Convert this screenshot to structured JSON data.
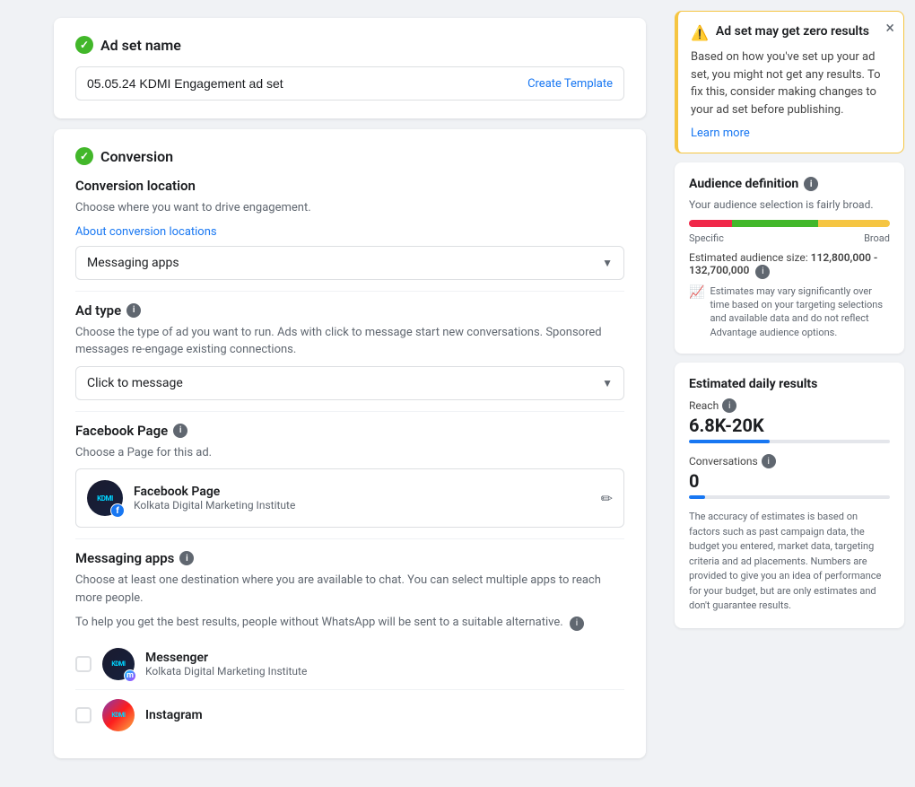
{
  "adset": {
    "section_title": "Ad set name",
    "name_value": "05.05.24 KDMI Engagement ad set",
    "create_template_label": "Create Template"
  },
  "conversion": {
    "section_title": "Conversion",
    "location_label": "Conversion location",
    "location_description": "Choose where you want to drive engagement.",
    "about_link": "About conversion locations",
    "location_dropdown": "Messaging apps",
    "ad_type_label": "Ad type",
    "ad_type_info": true,
    "ad_type_description": "Choose the type of ad you want to run. Ads with click to message start new conversations. Sponsored messages re-engage existing connections.",
    "ad_type_dropdown": "Click to message",
    "facebook_page_label": "Facebook Page",
    "facebook_page_info": true,
    "facebook_page_description": "Choose a Page for this ad.",
    "page_name": "Facebook Page",
    "page_subtitle": "Kolkata Digital Marketing Institute",
    "messaging_apps_label": "Messaging apps",
    "messaging_apps_info": true,
    "messaging_apps_desc1": "Choose at least one destination where you are available to chat. You can select multiple apps to reach more people.",
    "messaging_apps_desc2": "To help you get the best results, people without WhatsApp will be sent to a suitable alternative.",
    "messenger_name": "Messenger",
    "messenger_subtitle": "Kolkata Digital Marketing Institute",
    "instagram_name": "Instagram"
  },
  "warning": {
    "title": "Ad set may get zero results",
    "body": "Based on how you've set up your ad set, you might not get any results. To fix this, consider making changes to your ad set before publishing.",
    "learn_more": "Learn more"
  },
  "audience": {
    "title": "Audience definition",
    "description": "Your audience selection is fairly broad.",
    "label_specific": "Specific",
    "label_broad": "Broad",
    "size_label": "Estimated audience size:",
    "size_value": "112,800,000 - 132,700,000",
    "note": "Estimates may vary significantly over time based on your targeting selections and available data and do not reflect Advantage audience options."
  },
  "daily_results": {
    "title": "Estimated daily results",
    "reach_label": "Reach",
    "reach_info": true,
    "reach_value": "6.8K-20K",
    "conversations_label": "Conversations",
    "conversations_info": true,
    "conversations_value": "0",
    "accuracy_note": "The accuracy of estimates is based on factors such as past campaign data, the budget you entered, market data, targeting criteria and ad placements. Numbers are provided to give you an idea of performance for your budget, but are only estimates and don't guarantee results."
  }
}
